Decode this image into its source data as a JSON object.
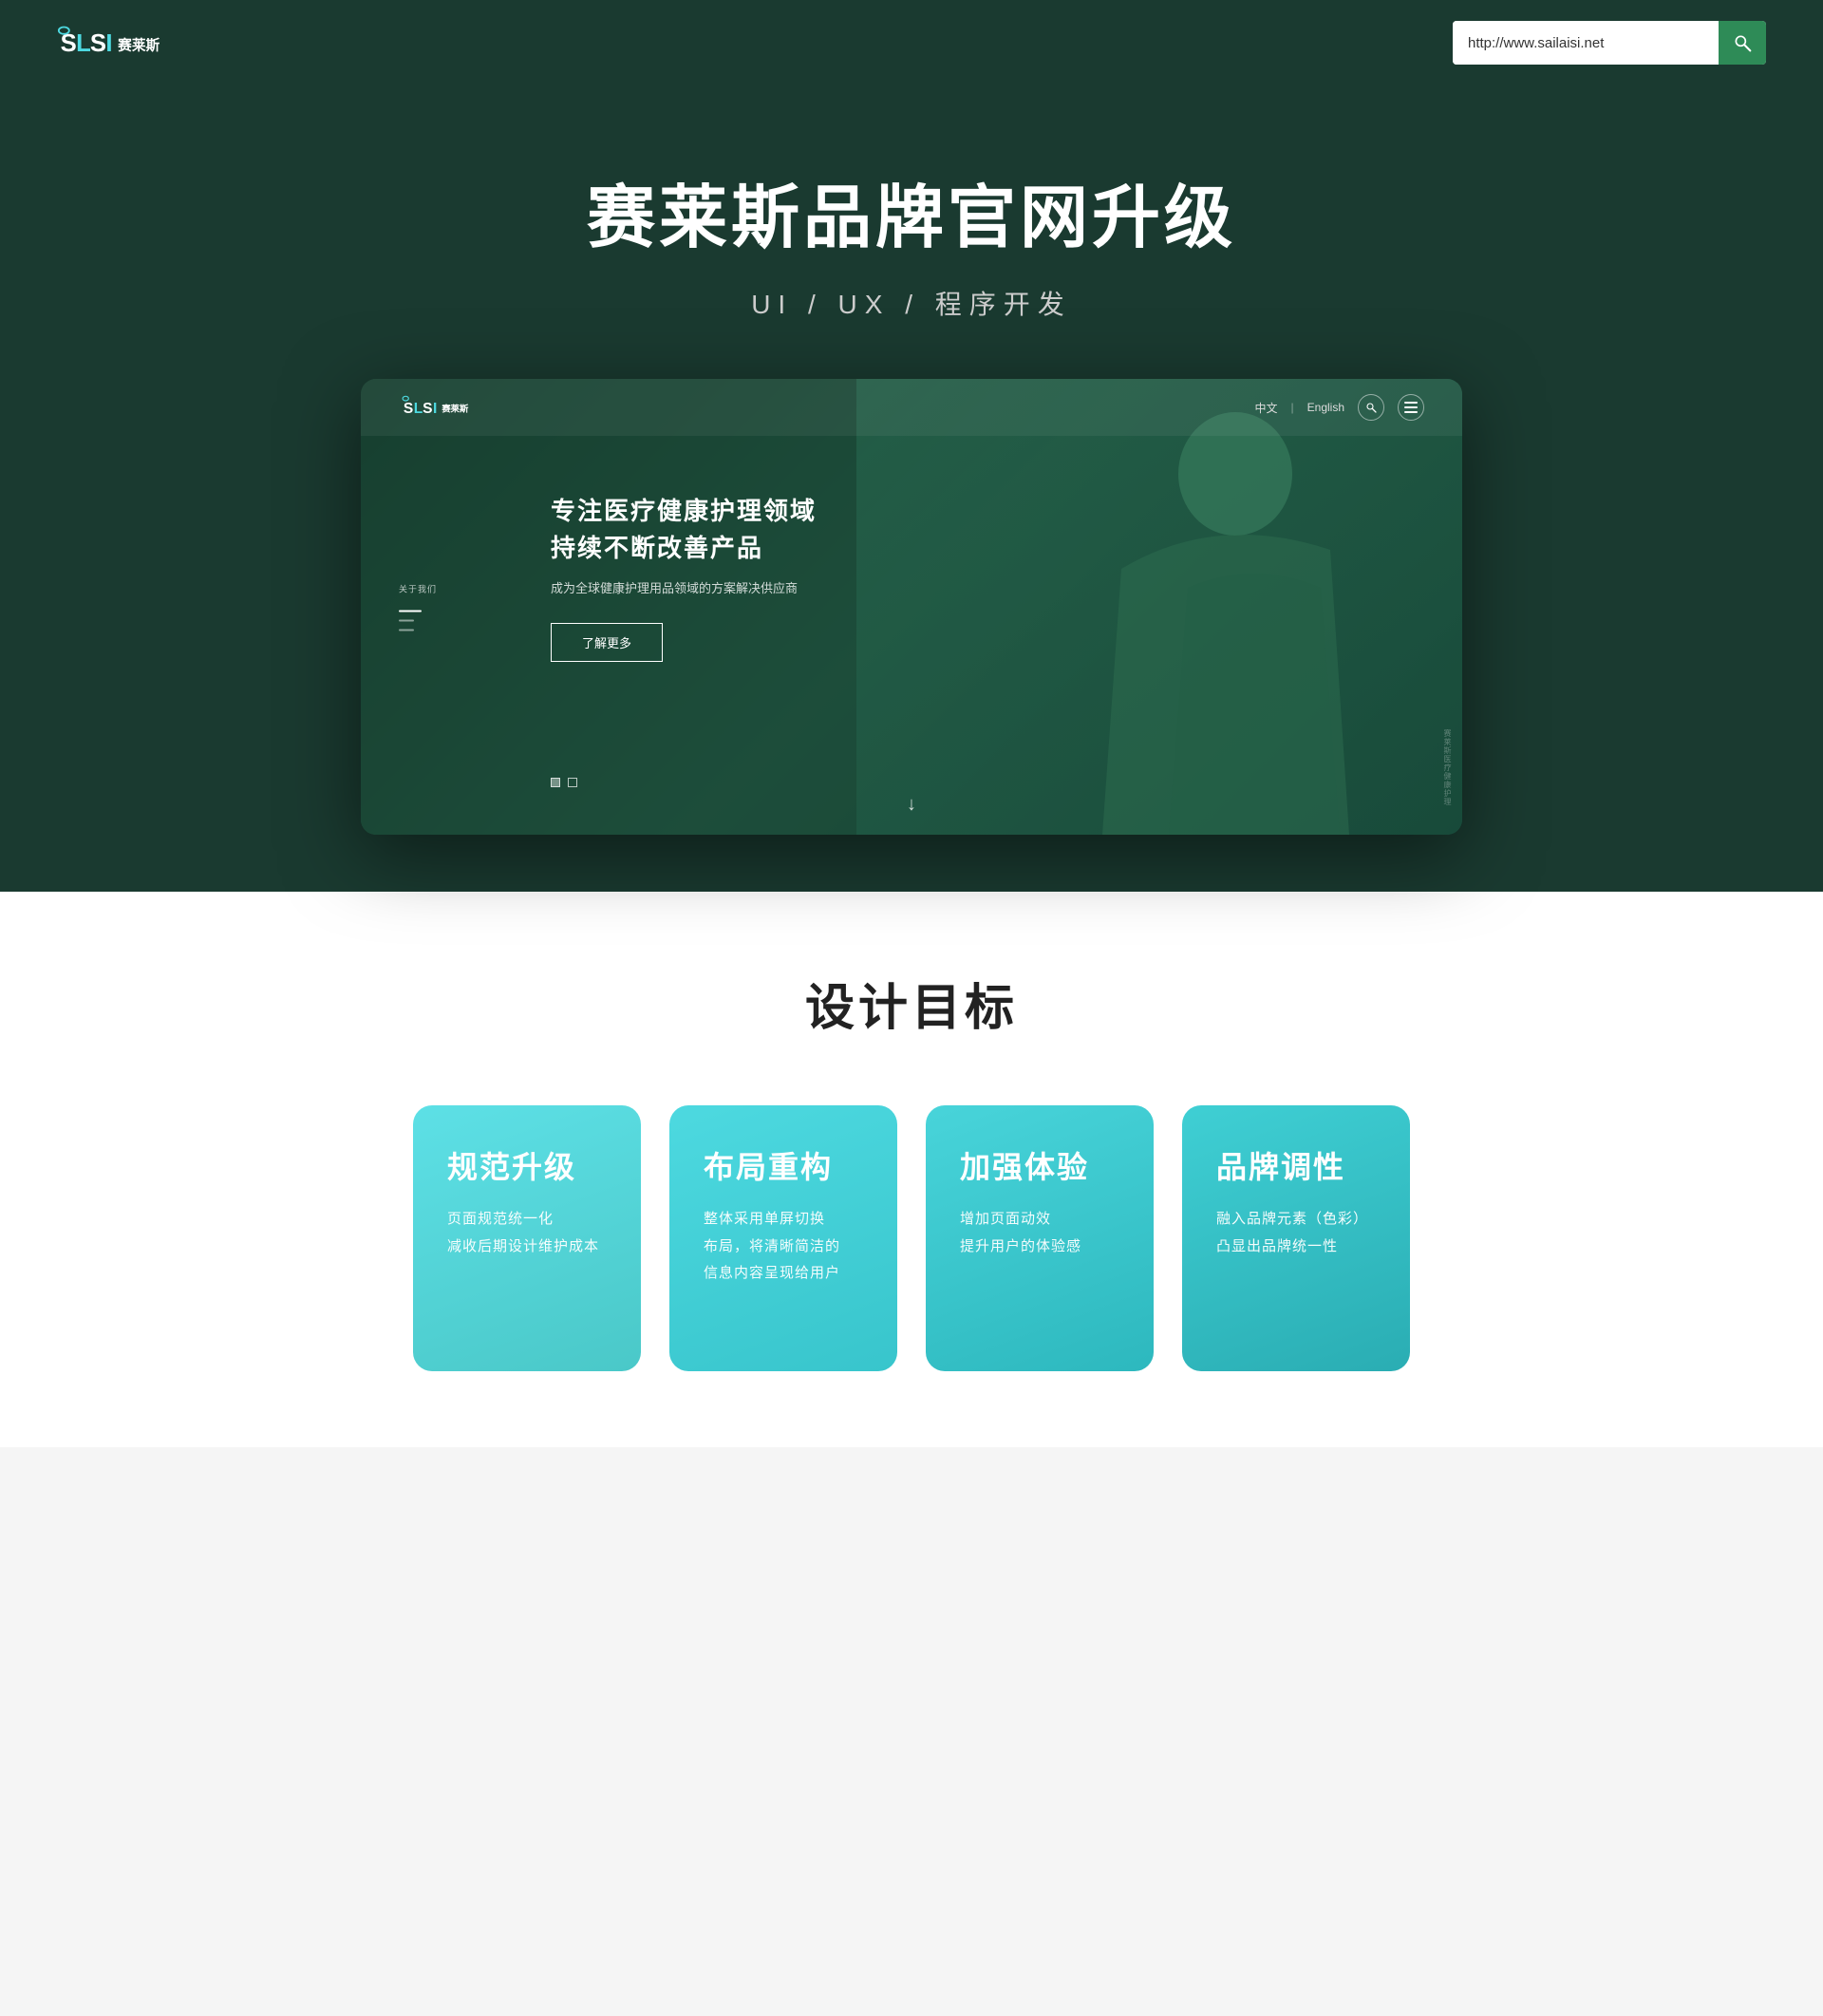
{
  "topNav": {
    "logoAlt": "SLSI 赛莱斯",
    "urlValue": "http://www.sailaisi.net",
    "searchPlaceholder": "http://www.sailaisi.net"
  },
  "hero": {
    "title": "赛莱斯品牌官网升级",
    "subtitle": "UI / UX / 程序开发"
  },
  "mockup": {
    "nav": {
      "logoText": "SLSI赛莱斯",
      "langZh": "中文",
      "separator": "|",
      "langEn": "English"
    },
    "heroTitle1": "专注医疗健康护理领域",
    "heroTitle2": "持续不断改善产品",
    "heroDesc": "成为全球健康护理用品领域的方案解决供应商",
    "ctaButton": "了解更多",
    "sideNavLabel": "关于我们",
    "cornerText": "赛莱斯医疗健康护理"
  },
  "designGoals": {
    "sectionTitle": "设计目标",
    "cards": [
      {
        "id": "card-1",
        "title": "规范升级",
        "desc": "页面规范统一化\n减收后期设计维护成本"
      },
      {
        "id": "card-2",
        "title": "布局重构",
        "desc": "整体采用单屏切换\n布局，将清晰简洁的\n信息内容呈现给用户"
      },
      {
        "id": "card-3",
        "title": "加强体验",
        "desc": "增加页面动效\n提升用户的体验感"
      },
      {
        "id": "card-4",
        "title": "品牌调性",
        "desc": "融入品牌元素（色彩）\n凸显出品牌统一性"
      }
    ]
  }
}
